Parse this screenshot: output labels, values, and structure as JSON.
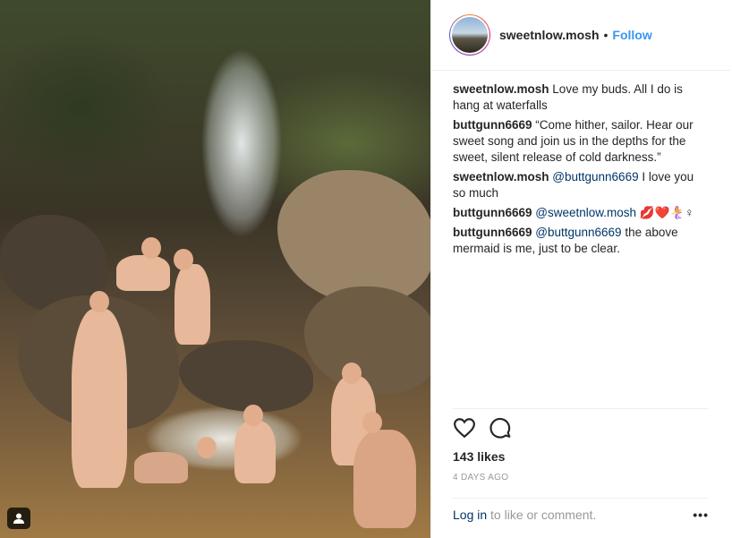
{
  "post": {
    "username": "sweetnlow.mosh",
    "separator": "•",
    "follow_label": "Follow",
    "comments": [
      {
        "user": "sweetnlow.mosh",
        "mention": "",
        "text": "Love my buds. All I do is hang at waterfalls"
      },
      {
        "user": "buttgunn6669",
        "mention": "",
        "text": "“Come hither, sailor. Hear our sweet song and join us in the depths for the sweet, silent release of cold darkness.”"
      },
      {
        "user": "sweetnlow.mosh",
        "mention": "@buttgunn6669",
        "text": "I love you so much"
      },
      {
        "user": "buttgunn6669",
        "mention": "@sweetnlow.mosh",
        "text": "💋❤️🧜‍♀️♀"
      },
      {
        "user": "buttgunn6669",
        "mention": "@buttgunn6669",
        "text": "the above mermaid is me, just to be clear."
      }
    ],
    "likes": "143 likes",
    "time_ago": "4 DAYS AGO",
    "login_link": "Log in",
    "login_suffix": "to like or comment.",
    "more_label": "•••"
  },
  "icons": {
    "like": "heart-icon",
    "comment": "comment-icon",
    "tagged": "user-tag-icon",
    "more": "more-options-icon"
  },
  "colors": {
    "accent": "#3897f0",
    "link": "#003569",
    "muted": "#999999",
    "text": "#262626"
  }
}
